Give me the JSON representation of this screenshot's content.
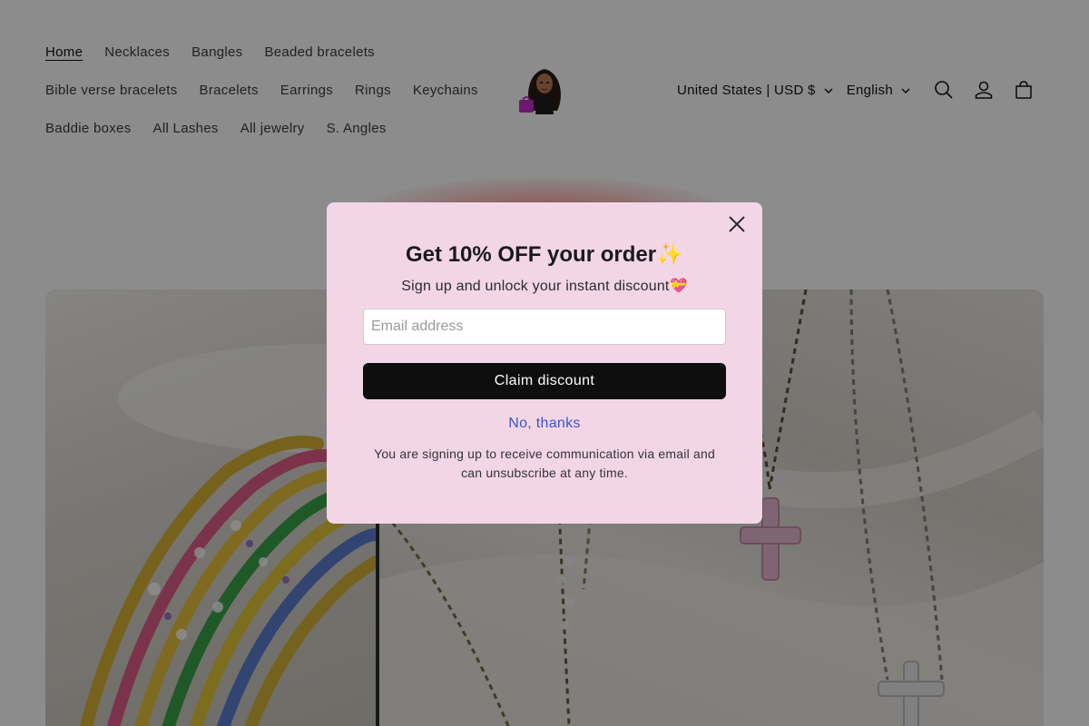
{
  "header": {
    "nav_rows": [
      [
        {
          "label": "Home",
          "active": true
        },
        {
          "label": "Necklaces"
        },
        {
          "label": "Bangles"
        },
        {
          "label": "Beaded bracelets"
        }
      ],
      [
        {
          "label": "Bible verse bracelets"
        },
        {
          "label": "Bracelets"
        },
        {
          "label": "Earrings"
        },
        {
          "label": "Rings"
        },
        {
          "label": "Keychains"
        }
      ],
      [
        {
          "label": "Baddie boxes"
        },
        {
          "label": "All Lashes"
        },
        {
          "label": "All jewelry"
        },
        {
          "label": "S. Angles"
        }
      ]
    ],
    "logo_icon": "brand-doll-logo",
    "country_selector": "United States | USD $",
    "language_selector": "English",
    "icons": [
      "search-icon",
      "account-icon",
      "cart-icon"
    ]
  },
  "popup": {
    "title": "Get 10% OFF your order✨",
    "subtitle": "Sign up and unlock your instant discount💝",
    "email_placeholder": "Email address",
    "email_value": "",
    "claim_button": "Claim discount",
    "decline_link": "No, thanks",
    "disclaimer": "You are signing up to receive communication via email and can unsubscribe at any time.",
    "close_icon": "close-icon"
  },
  "colors": {
    "popup_background": "#f3d6e6",
    "button_background": "#0e0e0e",
    "link": "#3b55c9",
    "overlay": "rgba(0,0,0,0.45)"
  }
}
